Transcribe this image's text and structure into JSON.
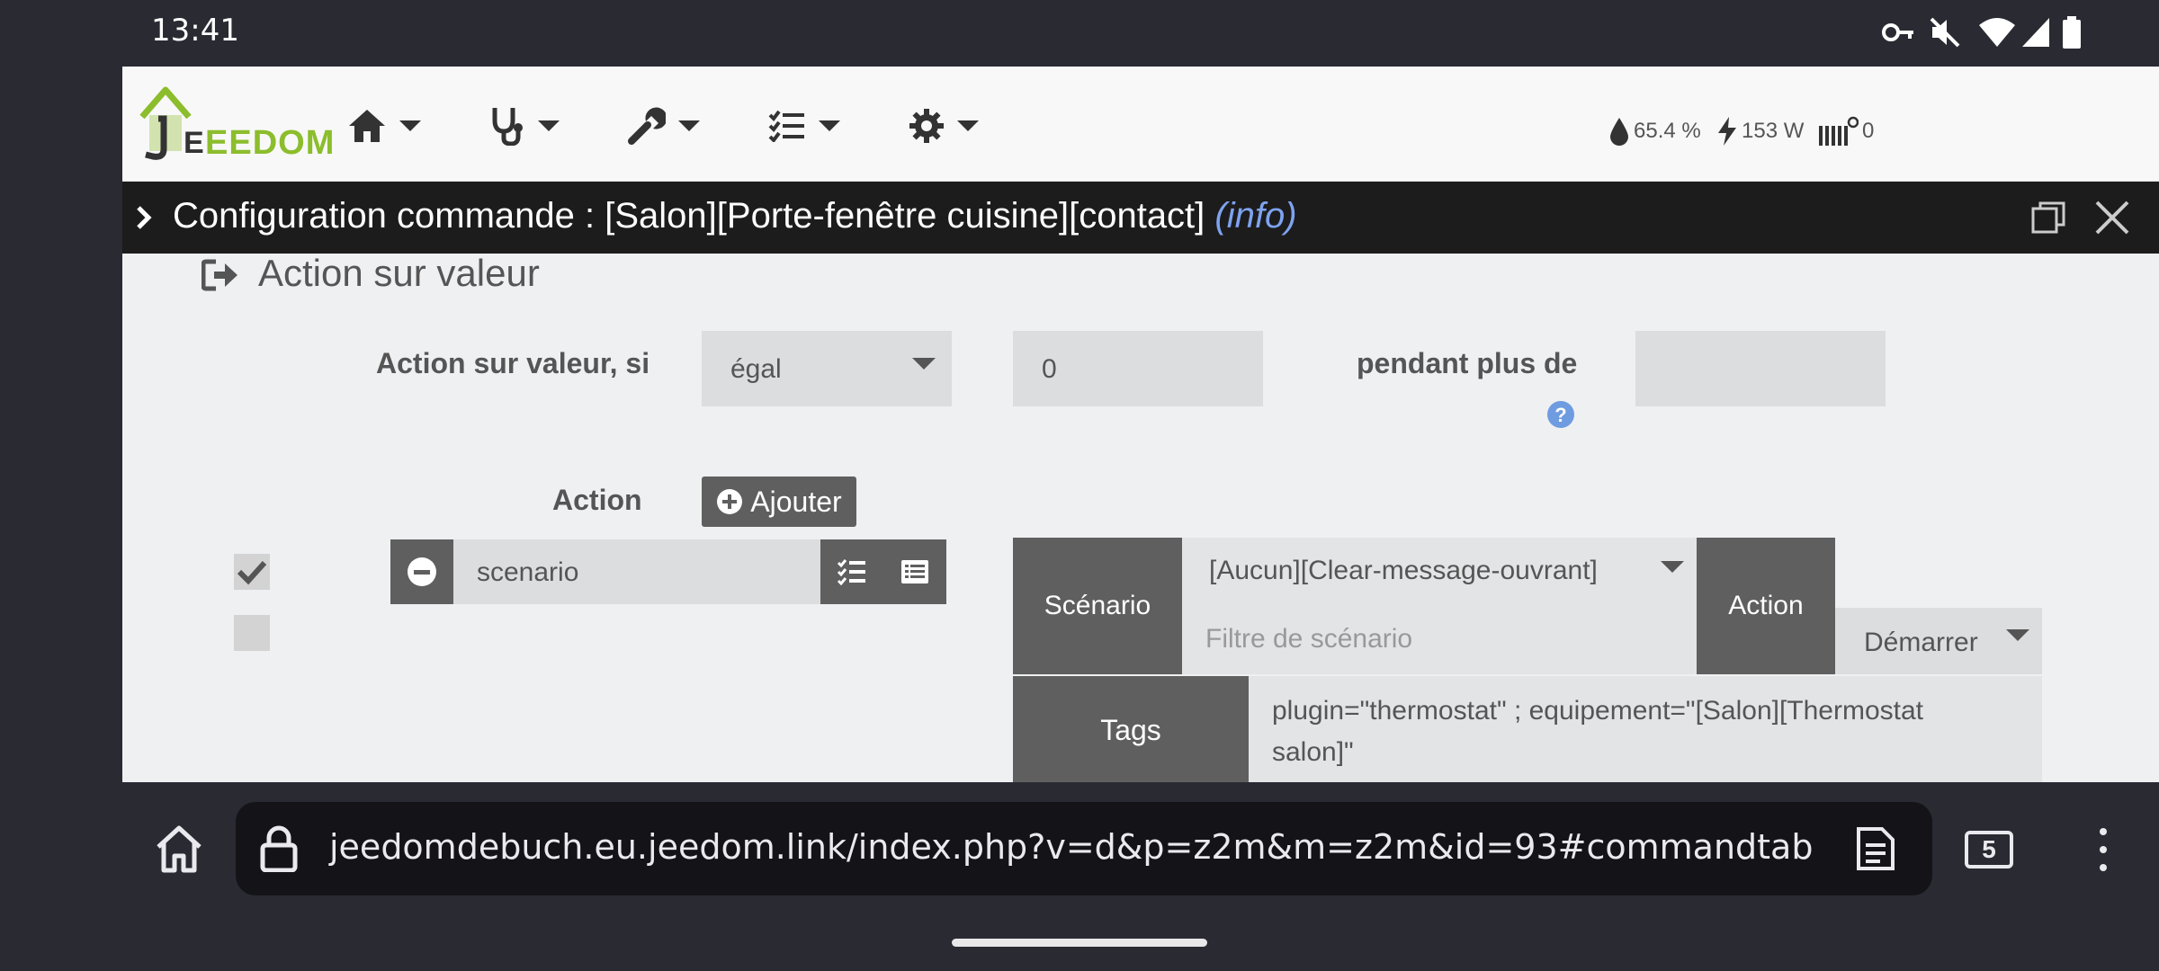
{
  "status_bar": {
    "time": "13:41"
  },
  "navbar": {
    "logo_text": "EEDOM",
    "info": {
      "humidity": "65.4 %",
      "power": "153 W",
      "count": "0"
    }
  },
  "modal": {
    "title": "Configuration commande : [Salon][Porte-fenêtre cuisine][contact]",
    "title_type": "(info)"
  },
  "section": {
    "heading": "Action sur valeur",
    "condition_label": "Action sur valeur, si",
    "operator_value": "égal",
    "compare_value": "0",
    "duration_label": "pendant plus de",
    "duration_value": "",
    "action_label": "Action",
    "add_button": "Ajouter"
  },
  "action_row": {
    "command": "scenario",
    "scenario_label": "Scénario",
    "scenario_value": "[Aucun][Clear-message-ouvrant]",
    "scenario_filter_placeholder": "Filtre de scénario",
    "action_label": "Action",
    "action_value": "Démarrer",
    "tags_label": "Tags",
    "tags_value": "plugin=\"thermostat\" ; equipement=\"[Salon][Thermostat salon]\""
  },
  "browser": {
    "url": "jeedomdebuch.eu.jeedom.link/index.php?v=d&p=z2m&m=z2m&id=93#commandtab",
    "tab_count": "5"
  },
  "colors": {
    "logo_green": "#8cbd2c",
    "info_link": "#7ea3f0",
    "help_icon": "#6f9be0",
    "dark_block": "#5f5f5f"
  }
}
